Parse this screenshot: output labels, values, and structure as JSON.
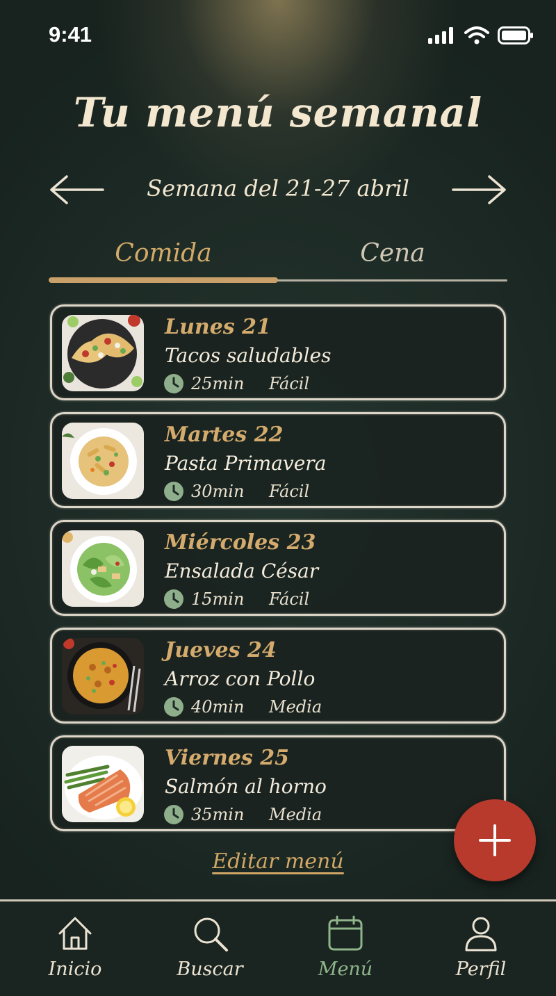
{
  "status_bar": {
    "time": "9:41"
  },
  "header": {
    "title": "Tu menú semanal",
    "week_label": "Semana del 21-27 abril"
  },
  "tabs": [
    {
      "label": "Comida",
      "active": true
    },
    {
      "label": "Cena",
      "active": false
    }
  ],
  "menu": [
    {
      "day": "Lunes 21",
      "dish": "Tacos saludables",
      "time": "25min",
      "difficulty": "Fácil",
      "image": "tacos"
    },
    {
      "day": "Martes 22",
      "dish": "Pasta Primavera",
      "time": "30min",
      "difficulty": "Fácil",
      "image": "pasta"
    },
    {
      "day": "Miércoles 23",
      "dish": "Ensalada César",
      "time": "15min",
      "difficulty": "Fácil",
      "image": "salad"
    },
    {
      "day": "Jueves 24",
      "dish": "Arroz con Pollo",
      "time": "40min",
      "difficulty": "Media",
      "image": "rice"
    },
    {
      "day": "Viernes 25",
      "dish": "Salmón al horno",
      "time": "35min",
      "difficulty": "Media",
      "image": "salmon"
    }
  ],
  "edit_link": "Editar menú",
  "nav": [
    {
      "label": "Inicio",
      "icon": "home-icon"
    },
    {
      "label": "Buscar",
      "icon": "search-icon"
    },
    {
      "label": "Menú",
      "icon": "calendar-icon",
      "active": true
    },
    {
      "label": "Perfil",
      "icon": "user-icon"
    }
  ],
  "colors": {
    "accent": "#d2aa68",
    "fab": "#b83a2c",
    "active_nav": "#8fb58a",
    "chalk": "#ddd6c8"
  }
}
